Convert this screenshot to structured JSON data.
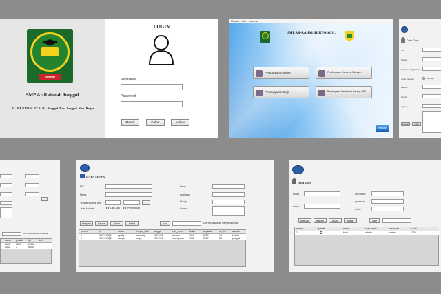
{
  "login": {
    "school_name": "SMP Ar-Rahmah Jonggol",
    "address": "JL. KP KARNI RT 01/04. Jonggol. Kec. Jonggol. Kab. Bogor",
    "logo_text": "SMP AR-RAHMAH JONGGOL",
    "logo_sub": "BOGOR",
    "title": "LOGIN",
    "username_label": "username",
    "password_label": "Password",
    "btn_masuk": "Masuk",
    "btn_daftar": "Daftar",
    "btn_keluar": "Keluar"
  },
  "menu": {
    "menubar": "Master   Info   Laporan",
    "title": "SMP AR-RAHMAH JONGGOL",
    "btn_siswa": "Pembayaran Siswa",
    "btn_ulangan": "Pembayaran Konfeksi Ulangan",
    "btn_gaji": "Pembayaran Gaji",
    "btn_ops": "Pembayaran Pembelian Barang OPS",
    "btn_keluar": "Keluar"
  },
  "top_right": {
    "title": "Data Guru",
    "labels": [
      "NIP",
      "Nama",
      "Tempat, tanggal lahir",
      "Jenis Kelamin",
      "Alamat",
      "No Hp",
      "Agama"
    ],
    "radio": "Laki-laki",
    "btn_simpan": "simpan",
    "btn_ubah": "ubah",
    "btn_hapus": "hapus"
  },
  "bottom_left": {
    "search_label": "cari berdasarkan nis/nama",
    "btn_cari": "cari",
    "header": [
      "nama",
      "jumlah",
      "tgl",
      "ket"
    ],
    "rows": [
      [
        "2001",
        "1200",
        "2106",
        ""
      ],
      [
        "2002",
        "3",
        "5000",
        ""
      ]
    ]
  },
  "siswa": {
    "title": "DATA SISWA",
    "labels_left": [
      "NIS",
      "Nama",
      "Tempat tanggal lahir",
      "Jenis kelamin"
    ],
    "labels_right": [
      "Kelas",
      "Angkatan",
      "No Hp",
      "Alamat"
    ],
    "radio_l": "Laki-Laki",
    "radio_p": "Perempuan",
    "buttons": [
      "simpan",
      "hapus",
      "ubah",
      "batal"
    ],
    "btn_cari": "cari",
    "search_hint": "cari berdasarkan nis/nama/kelas",
    "header": [
      "nomor",
      "nis",
      "nama",
      "tempat_lahir",
      "tanggal",
      "jenis_kela",
      "kelas",
      "angkatan",
      "no_hp",
      "alamat"
    ],
    "rows": [
      [
        "1",
        "2017/1SIQ1",
        "syafiq",
        "bandung",
        "2017/4/2",
        "laki-laki",
        "VIIA",
        "2017",
        "99",
        "bekasi"
      ],
      [
        "2",
        "2017/1SIQ2",
        "bunga",
        "bogor",
        "2017/4/2",
        "perempuan",
        "VIIB",
        "2017",
        "88",
        "jonggol"
      ]
    ]
  },
  "user": {
    "title": "Data User",
    "labels_left": [
      "akses",
      "nama"
    ],
    "labels_right": [
      "username",
      "password",
      "no hp"
    ],
    "buttons": [
      "simpan",
      "hapus",
      "ubah",
      "batal"
    ],
    "btn_cari": "cari",
    "header": [
      "nomor",
      "jumlah",
      "nama",
      "user name",
      "password",
      "no hp"
    ],
    "rows": [
      [
        "1",
        "",
        "budi",
        "admin",
        "admin",
        "1234"
      ]
    ]
  }
}
